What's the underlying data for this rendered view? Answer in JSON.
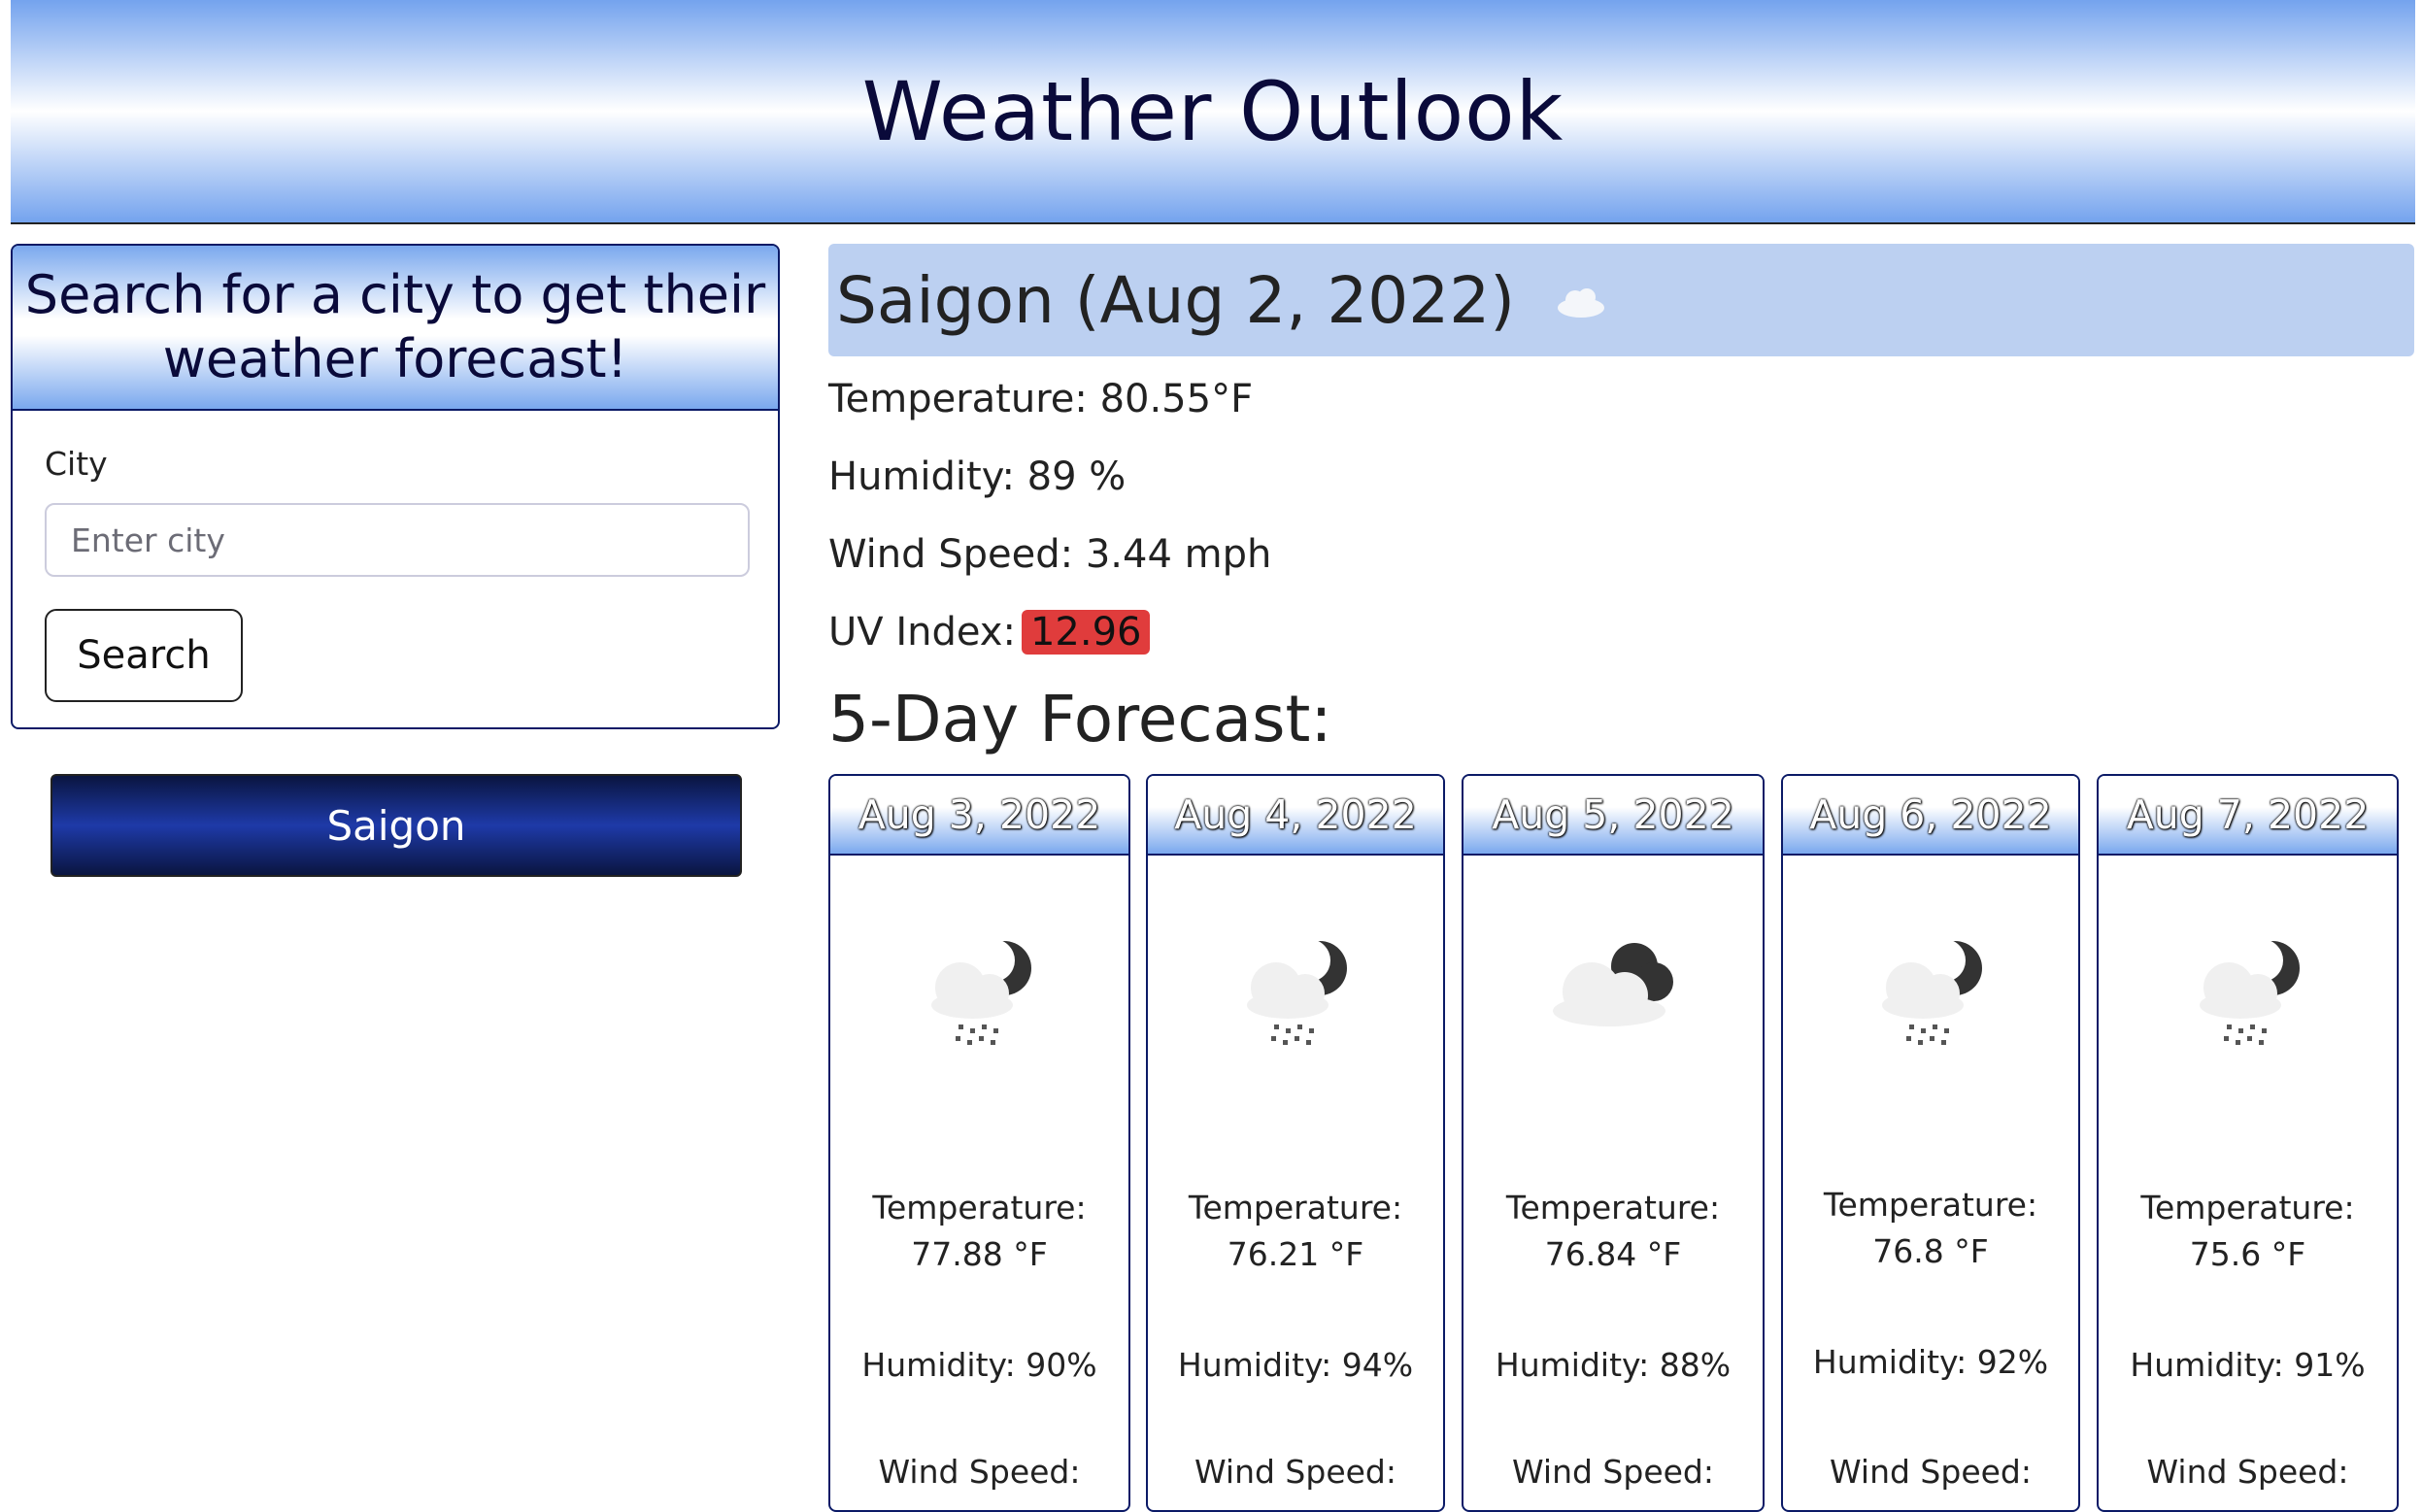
{
  "header": {
    "title": "Weather Outlook"
  },
  "search": {
    "heading": "Search for a city to get their weather forecast!",
    "city_label": "City",
    "placeholder": "Enter city",
    "button_label": "Search"
  },
  "history": [
    {
      "label": "Saigon"
    }
  ],
  "current": {
    "title": "Saigon (Aug 2, 2022)",
    "icon": "cloud-icon",
    "temperature": "Temperature: 80.55°F",
    "humidity": "Humidity: 89 %",
    "wind": "Wind Speed: 3.44 mph",
    "uv_label": "UV Index:",
    "uv_value": "12.96",
    "uv_color": "#e03c3c"
  },
  "forecast_title": "5-Day Forecast:",
  "forecast": [
    {
      "date": "Aug 3, 2022",
      "icon": "rain-night-icon",
      "temp_label": "Temperature:",
      "temp": "77.88 °F",
      "humidity": "Humidity: 90%",
      "wind": "Wind Speed:"
    },
    {
      "date": "Aug 4, 2022",
      "icon": "rain-night-icon",
      "temp_label": "Temperature:",
      "temp": "76.21 °F",
      "humidity": "Humidity: 94%",
      "wind": "Wind Speed:"
    },
    {
      "date": "Aug 5, 2022",
      "icon": "cloudy-night-icon",
      "temp_label": "Temperature:",
      "temp": "76.84 °F",
      "humidity": "Humidity: 88%",
      "wind": "Wind Speed:"
    },
    {
      "date": "Aug 6, 2022",
      "icon": "rain-night-icon",
      "temp_label": "Temperature:",
      "temp": "76.8 °F",
      "humidity": "Humidity: 92%",
      "wind": "Wind Speed:"
    },
    {
      "date": "Aug 7, 2022",
      "icon": "rain-night-icon",
      "temp_label": "Temperature:",
      "temp": "75.6 °F",
      "humidity": "Humidity: 91%",
      "wind": "Wind Speed:"
    }
  ]
}
